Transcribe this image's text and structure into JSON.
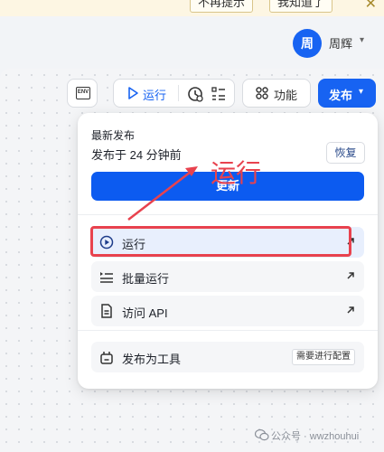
{
  "notice": {
    "btn1": "不再提示",
    "btn2": "我知道了",
    "close": "✕"
  },
  "user": {
    "avatar_char": "周",
    "name": "周辉",
    "chevron": "⌄"
  },
  "toolbar": {
    "env_label": "ENV",
    "run_label": "运行",
    "function_label": "功能",
    "publish_label": "发布",
    "publish_chevron": "⌄"
  },
  "publish_panel": {
    "recent_title": "最新发布",
    "recent_time": "发布于 24 分钟前",
    "restore_label": "恢复",
    "update_label": "更新",
    "items": [
      {
        "label": "运行",
        "icon": "play-circle-icon",
        "arrow": "arrow-up-right-icon"
      },
      {
        "label": "批量运行",
        "icon": "list-icon",
        "arrow": "arrow-up-right-icon"
      },
      {
        "label": "访问 API",
        "icon": "document-icon",
        "arrow": "arrow-up-right-icon"
      }
    ],
    "tool_item": {
      "label": "发布为工具",
      "icon": "tool-icon",
      "badge": "需要进行配置"
    }
  },
  "annotation": {
    "text": "运行",
    "color": "#e8424e"
  },
  "watermark": {
    "text": "公众号 · wwzhouhui"
  },
  "colors": {
    "primary": "#1763f2",
    "annotation": "#e8424e"
  }
}
